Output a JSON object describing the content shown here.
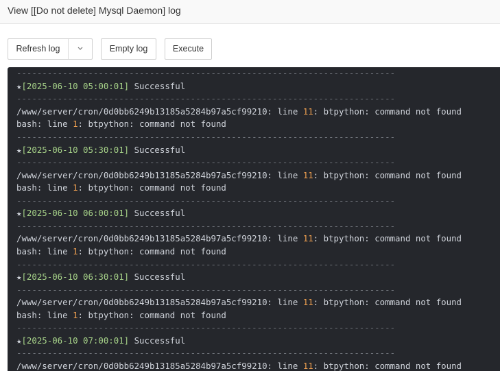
{
  "window": {
    "title": "View [[Do not delete] Mysql Daemon] log"
  },
  "toolbar": {
    "refresh_label": "Refresh log",
    "empty_label": "Empty log",
    "execute_label": "Execute"
  },
  "log": {
    "separator": "--------------------------------------------------------------------------",
    "star": "★",
    "entries": [
      {
        "timestamp": "[2025-06-10 05:00:01]",
        "status": " Successful",
        "error_prefix": "/www/server/cron/0d0bb6249b13185a5284b97a5cf99210: line ",
        "error_line_num": "11",
        "error_suffix": ": btpython: command not found",
        "bash_prefix": "bash: line ",
        "bash_line_num": "1",
        "bash_suffix": ": btpython: command not found"
      },
      {
        "timestamp": "[2025-06-10 05:30:01]",
        "status": " Successful",
        "error_prefix": "/www/server/cron/0d0bb6249b13185a5284b97a5cf99210: line ",
        "error_line_num": "11",
        "error_suffix": ": btpython: command not found",
        "bash_prefix": "bash: line ",
        "bash_line_num": "1",
        "bash_suffix": ": btpython: command not found"
      },
      {
        "timestamp": "[2025-06-10 06:00:01]",
        "status": " Successful",
        "error_prefix": "/www/server/cron/0d0bb6249b13185a5284b97a5cf99210: line ",
        "error_line_num": "11",
        "error_suffix": ": btpython: command not found",
        "bash_prefix": "bash: line ",
        "bash_line_num": "1",
        "bash_suffix": ": btpython: command not found"
      },
      {
        "timestamp": "[2025-06-10 06:30:01]",
        "status": " Successful",
        "error_prefix": "/www/server/cron/0d0bb6249b13185a5284b97a5cf99210: line ",
        "error_line_num": "11",
        "error_suffix": ": btpython: command not found",
        "bash_prefix": "bash: line ",
        "bash_line_num": "1",
        "bash_suffix": ": btpython: command not found"
      },
      {
        "timestamp": "[2025-06-10 07:00:01]",
        "status": " Successful",
        "error_prefix": "/www/server/cron/0d0bb6249b13185a5284b97a5cf99210: line ",
        "error_line_num": "11",
        "error_suffix": ": btpython: command not found"
      }
    ]
  },
  "colors": {
    "log_background": "#25272c",
    "timestamp": "#a8d48a",
    "line_number": "#f0a050",
    "separator": "#6d7178"
  }
}
